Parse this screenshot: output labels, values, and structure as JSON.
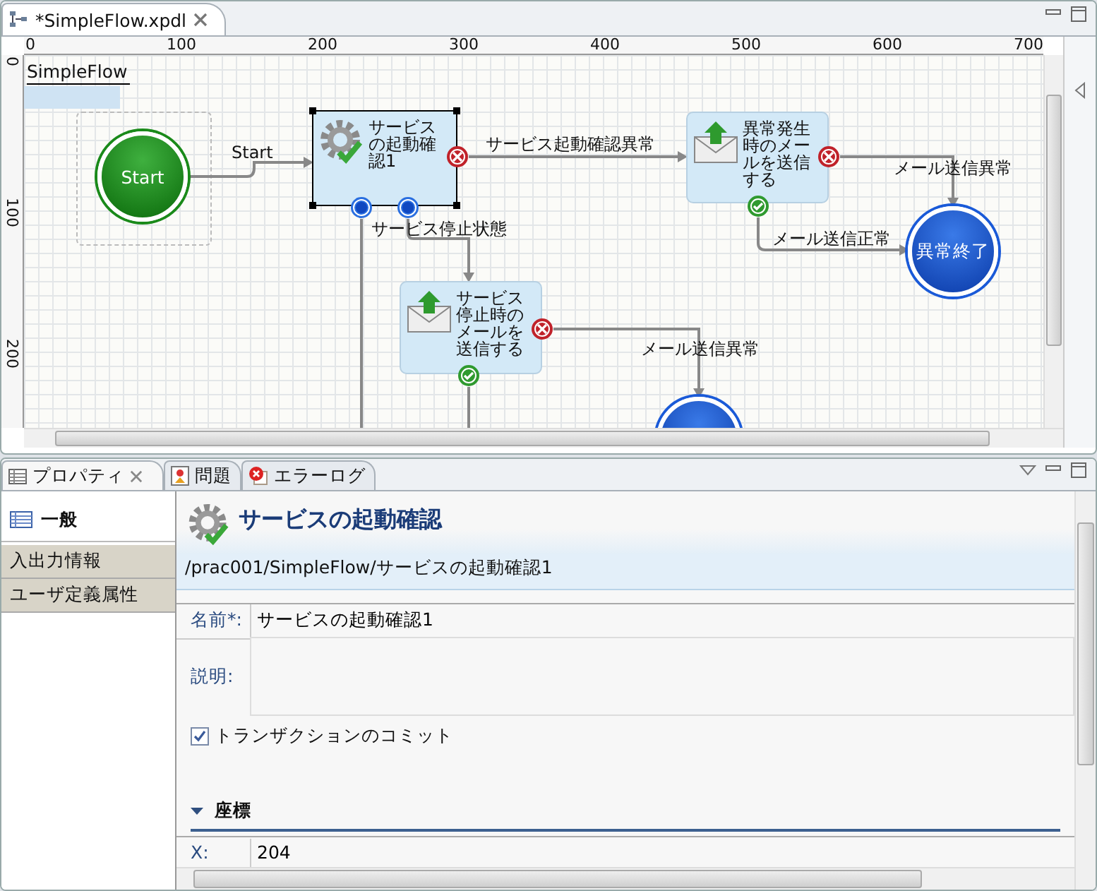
{
  "editor": {
    "tab": {
      "title": "*SimpleFlow.xpdl",
      "selected": true
    },
    "ruler": {
      "x_labels": [
        "0",
        "100",
        "200",
        "300",
        "400",
        "500",
        "600",
        "700"
      ],
      "y_labels": [
        "0",
        "100",
        "200"
      ]
    },
    "diagram": {
      "pool_label": "SimpleFlow",
      "nodes": [
        {
          "kind": "start",
          "label": "Start",
          "selected": false
        },
        {
          "kind": "service",
          "label": "サービスの起動確認1",
          "selected": true
        },
        {
          "kind": "mail",
          "label": "異常発生時のメールを送信する",
          "selected": false
        },
        {
          "kind": "end",
          "label": "異常終了",
          "selected": false
        },
        {
          "kind": "mail",
          "label": "サービス停止時のメールを送信する",
          "selected": false
        },
        {
          "kind": "end",
          "selected": false
        }
      ],
      "edges": [
        {
          "label": "Start"
        },
        {
          "label": "サービス起動確認異常"
        },
        {
          "label": "メール送信異常"
        },
        {
          "label": "メール送信正常"
        },
        {
          "label": "サービス停止状態"
        },
        {
          "label": "メール送信異常"
        }
      ]
    }
  },
  "properties": {
    "tabs": [
      {
        "label": "プロパティ",
        "selected": true,
        "closable": true
      },
      {
        "label": "問題",
        "selected": false,
        "closable": false
      },
      {
        "label": "エラーログ",
        "selected": false,
        "closable": false
      }
    ],
    "sidebar": [
      {
        "label": "一般",
        "selected": true
      },
      {
        "label": "入出力情報",
        "selected": false
      },
      {
        "label": "ユーザ定義属性",
        "selected": false
      }
    ],
    "header": {
      "title": "サービスの起動確認",
      "path": "/prac001/SimpleFlow/サービスの起動確認1"
    },
    "fields": [
      {
        "kind": "text",
        "label": "名前*:",
        "value": "サービスの起動確認1"
      },
      {
        "kind": "textarea",
        "label": "説明:"
      }
    ],
    "commit": {
      "label": "トランザクションのコミット",
      "checked": true
    },
    "section": {
      "title": "座標",
      "expanded": true,
      "fields": [
        {
          "label": "X:",
          "value": "204"
        }
      ]
    }
  }
}
